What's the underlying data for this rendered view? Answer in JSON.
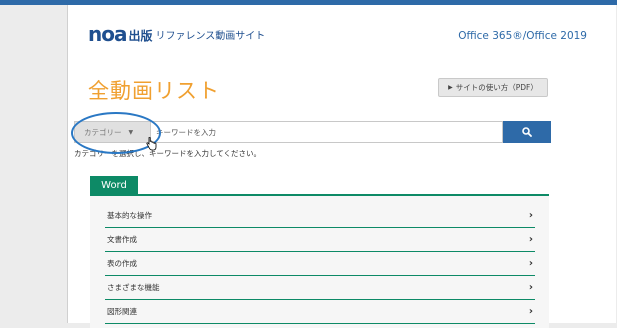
{
  "header": {
    "logo": "noa",
    "publisher": "出版",
    "site_name": "リファレンス動画サイト",
    "product": "Office 365®/Office 2019"
  },
  "page": {
    "title": "全動画リスト",
    "guide_button": "サイトの使い方（PDF）"
  },
  "search": {
    "category_label": "カテゴリー",
    "keyword_placeholder": "キーワードを入力",
    "hint": "カテゴリーを選択し、キーワードを入力してください。"
  },
  "section": {
    "tab": "Word",
    "items": [
      {
        "label": "基本的な操作"
      },
      {
        "label": "文書作成"
      },
      {
        "label": "表の作成"
      },
      {
        "label": "さまざまな機能"
      },
      {
        "label": "図形関連"
      }
    ]
  },
  "colors": {
    "brand": "#1f4f8f",
    "title": "#f0a030",
    "accent": "#2e6aa8",
    "word_green": "#0d8a66",
    "annotation": "#2a78c4"
  }
}
